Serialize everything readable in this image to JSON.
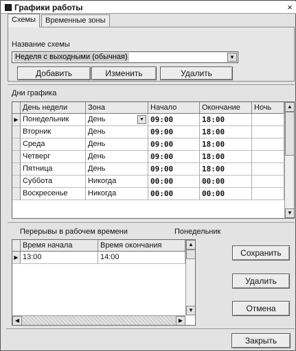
{
  "window": {
    "title": "Графики работы",
    "close_glyph": "×"
  },
  "tabs": [
    {
      "label": "Схемы",
      "active": true
    },
    {
      "label": "Временные зоны",
      "active": false
    }
  ],
  "scheme": {
    "label": "Название схемы",
    "selected": "Неделя с выходными (обычная)",
    "buttons": {
      "add": "Добавить",
      "edit": "Изменить",
      "delete": "Удалить"
    }
  },
  "days": {
    "section_label": "Дни графика",
    "columns": [
      "День недели",
      "Зона",
      "Начало",
      "Окончание",
      "Ночь"
    ],
    "rows": [
      {
        "day": "Понедельник",
        "zone": "День",
        "start": "09:00",
        "end": "18:00",
        "night": ""
      },
      {
        "day": "Вторник",
        "zone": "День",
        "start": "09:00",
        "end": "18:00",
        "night": ""
      },
      {
        "day": "Среда",
        "zone": "День",
        "start": "09:00",
        "end": "18:00",
        "night": ""
      },
      {
        "day": "Четверг",
        "zone": "День",
        "start": "09:00",
        "end": "18:00",
        "night": ""
      },
      {
        "day": "Пятница",
        "zone": "День",
        "start": "09:00",
        "end": "18:00",
        "night": ""
      },
      {
        "day": "Суббота",
        "zone": "Никогда",
        "start": "00:00",
        "end": "00:00",
        "night": ""
      },
      {
        "day": "Воскресенье",
        "zone": "Никогда",
        "start": "00:00",
        "end": "00:00",
        "night": ""
      }
    ]
  },
  "breaks": {
    "section_label": "Перерывы в рабочем времени",
    "current_day": "Понедельник",
    "columns": [
      "Время начала",
      "Время окончания"
    ],
    "rows": [
      {
        "start": "13:00",
        "end": "14:00"
      }
    ]
  },
  "side_buttons": {
    "save": "Сохранить",
    "delete": "Удалить",
    "cancel": "Отмена"
  },
  "footer": {
    "close": "Закрыть"
  },
  "icons": {
    "row_pointer": "▶",
    "dropdown": "▼",
    "scroll_up": "▲",
    "scroll_down": "▼",
    "scroll_left": "◀",
    "scroll_right": "▶"
  }
}
